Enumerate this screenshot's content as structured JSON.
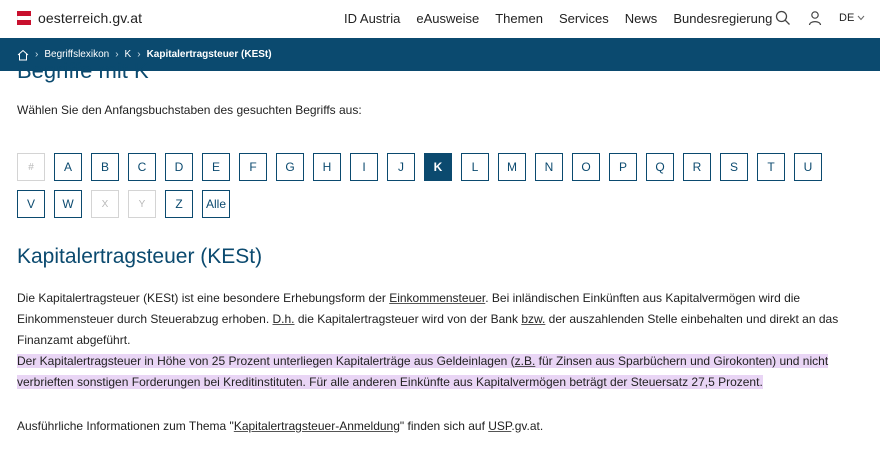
{
  "header": {
    "brand": "oesterreich.gv.at",
    "nav": [
      "ID Austria",
      "eAusweise",
      "Themen",
      "Services",
      "News",
      "Bundesregierung"
    ],
    "lang": "DE"
  },
  "breadcrumb": {
    "items": [
      "Begriffslexikon",
      "K",
      "Kapitalertragsteuer (KESt)"
    ]
  },
  "clipped_heading": "Begriffe mit K",
  "intro": "Wählen Sie den Anfangsbuchstaben des gesuchten Begriffs aus:",
  "letters": [
    {
      "label": "#",
      "state": "disabled"
    },
    {
      "label": "A",
      "state": "enabled"
    },
    {
      "label": "B",
      "state": "enabled"
    },
    {
      "label": "C",
      "state": "enabled"
    },
    {
      "label": "D",
      "state": "enabled"
    },
    {
      "label": "E",
      "state": "enabled"
    },
    {
      "label": "F",
      "state": "enabled"
    },
    {
      "label": "G",
      "state": "enabled"
    },
    {
      "label": "H",
      "state": "enabled"
    },
    {
      "label": "I",
      "state": "enabled"
    },
    {
      "label": "J",
      "state": "enabled"
    },
    {
      "label": "K",
      "state": "active"
    },
    {
      "label": "L",
      "state": "enabled"
    },
    {
      "label": "M",
      "state": "enabled"
    },
    {
      "label": "N",
      "state": "enabled"
    },
    {
      "label": "O",
      "state": "enabled"
    },
    {
      "label": "P",
      "state": "enabled"
    },
    {
      "label": "Q",
      "state": "enabled"
    },
    {
      "label": "R",
      "state": "enabled"
    },
    {
      "label": "S",
      "state": "enabled"
    },
    {
      "label": "T",
      "state": "enabled"
    },
    {
      "label": "U",
      "state": "enabled"
    },
    {
      "label": "V",
      "state": "enabled"
    },
    {
      "label": "W",
      "state": "enabled"
    },
    {
      "label": "X",
      "state": "disabled"
    },
    {
      "label": "Y",
      "state": "disabled"
    },
    {
      "label": "Z",
      "state": "enabled"
    },
    {
      "label": "Alle",
      "state": "enabled"
    }
  ],
  "article": {
    "title": "Kapitalertragsteuer (KESt)",
    "p1": {
      "t1": "Die Kapitalertragsteuer (KESt) ist eine besondere Erhebungsform der ",
      "link1": "Einkommensteuer",
      "t2": ". Bei inländischen Einkünften aus Kapitalvermögen wird die Einkommensteuer durch Steuerabzug erhoben. ",
      "abbr1": "D.h.",
      "t3": " die Kapitalertragsteuer wird von der Bank ",
      "abbr2": "bzw.",
      "t4": " der auszahlenden Stelle einbehalten und direkt an das Finanzamt abgeführt."
    },
    "p2": {
      "t1": "Der Kapitalertragsteuer in Höhe von 25 Prozent unterliegen Kapitalerträge aus Geldeinlagen (",
      "abbr1": "z.B.",
      "t2": " für Zinsen aus Sparbüchern und Girokonten) und nicht verbrieften sonstigen Forderungen bei Kreditinstituten. Für alle anderen Einkünfte aus Kapitalvermögen beträgt der Steuersatz 27,5 Prozent."
    },
    "p3": {
      "t1": "Ausführliche Informationen zum Thema \"",
      "link1": "Kapitalertragsteuer-Anmeldung",
      "t2": "\" finden sich auf ",
      "link2": "USP",
      "t3": ".gv.at."
    }
  },
  "colors": {
    "primary": "#0b4a6f",
    "highlight": "#e9d5f5",
    "flag_red": "#c8102e"
  },
  "icons": [
    "search-icon",
    "user-icon",
    "chevron-down-icon",
    "home-icon"
  ]
}
